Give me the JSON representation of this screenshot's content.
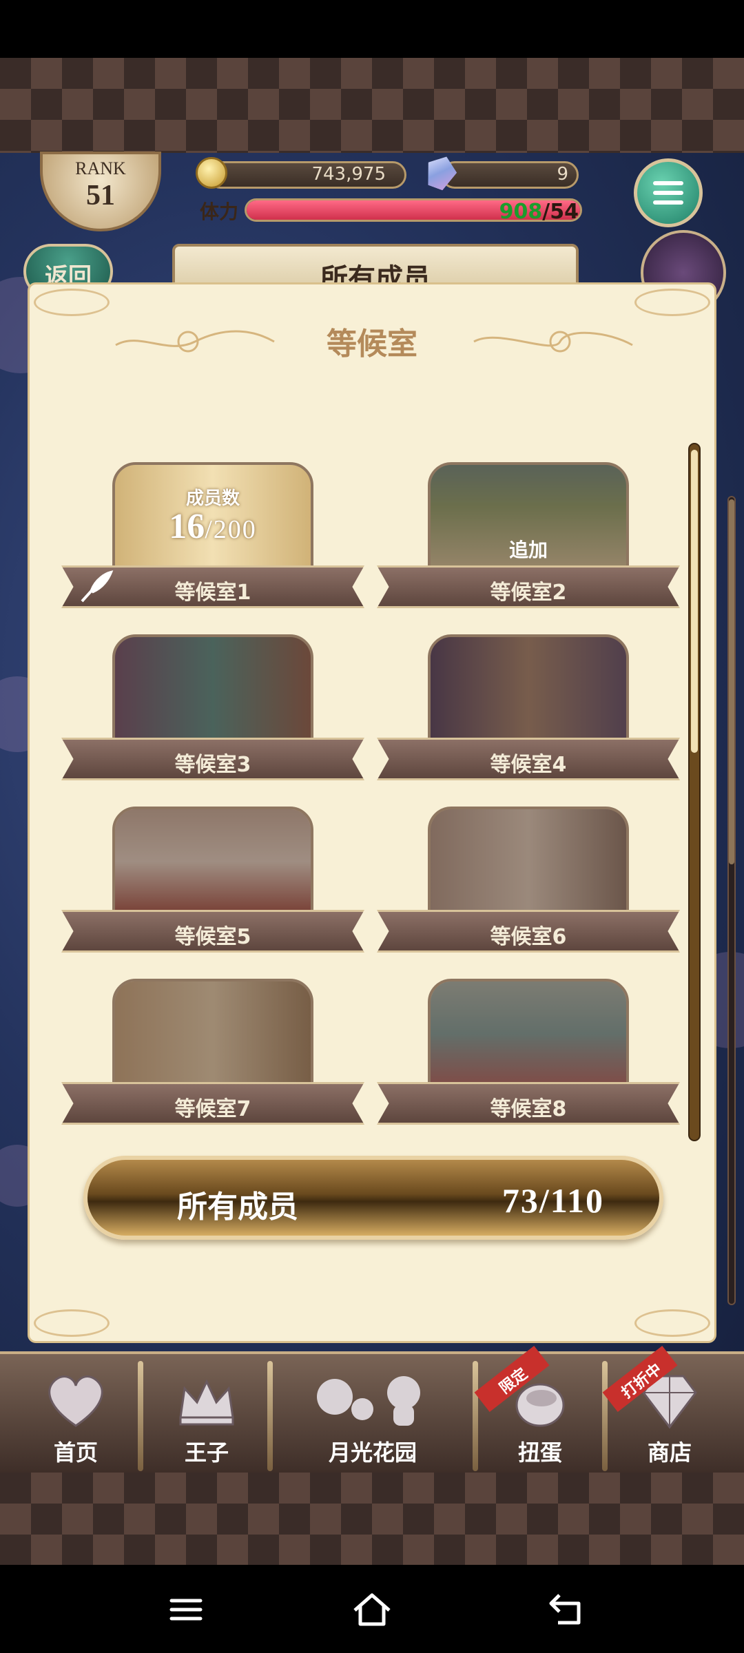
{
  "header": {
    "rank_label": "RANK",
    "rank_value": "51",
    "gold": "743,975",
    "gems": "9",
    "stamina_label": "体力",
    "stamina_current": "908",
    "stamina_max": "/54",
    "stamina_fill_fraction": 1.0,
    "back_label": "返回",
    "screen_title": "所有成员"
  },
  "panel": {
    "title": "等候室",
    "rooms": [
      {
        "name": "等候室1",
        "members_label": "成员数",
        "members_current": "16",
        "members_total": "/200",
        "active": true
      },
      {
        "name": "等候室2",
        "add_label": "追加"
      },
      {
        "name": "等候室3"
      },
      {
        "name": "等候室4"
      },
      {
        "name": "等候室5"
      },
      {
        "name": "等候室6"
      },
      {
        "name": "等候室7"
      },
      {
        "name": "等候室8"
      }
    ],
    "all_members_label": "所有成员",
    "all_members_count": "73/110"
  },
  "bottom_nav": {
    "items": [
      {
        "label": "首页",
        "icon": "heart-icon"
      },
      {
        "label": "王子",
        "icon": "crown-icon"
      },
      {
        "label": "月光花园",
        "icon": "garden-characters-icon"
      },
      {
        "label": "扭蛋",
        "icon": "gacha-egg-icon",
        "badge": "限定"
      },
      {
        "label": "商店",
        "icon": "crystal-shop-icon",
        "badge": "打折中"
      }
    ]
  },
  "colors": {
    "panel_bg": "#f8f0d6",
    "title_color": "#b48a5a",
    "ribbon": "#6e544a",
    "menu_button": "#2f9c7e",
    "badge_red": "#c8302c"
  }
}
